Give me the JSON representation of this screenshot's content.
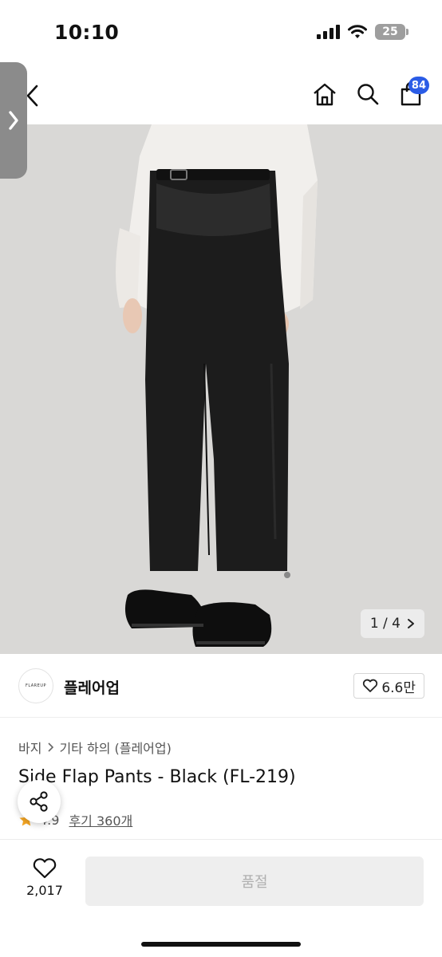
{
  "status_bar": {
    "time": "10:10",
    "battery": "25"
  },
  "nav": {
    "cart_count": "84"
  },
  "gallery": {
    "counter": "1 / 4"
  },
  "brand": {
    "logo_text": "FLAREUP",
    "name": "플레어업",
    "likes": "6.6만"
  },
  "breadcrumb": [
    "바지",
    "기타 하의 (플레어업)"
  ],
  "product": {
    "title": "Side Flap Pants - Black (FL-219)",
    "rating": "4.9",
    "reviews": "후기 360개"
  },
  "bottom_bar": {
    "wish_count": "2,017",
    "sold_out_label": "품절"
  },
  "colors": {
    "badge": "#2b5ce6",
    "side_tab": "#8b8b8b",
    "star": "#f5a623"
  }
}
